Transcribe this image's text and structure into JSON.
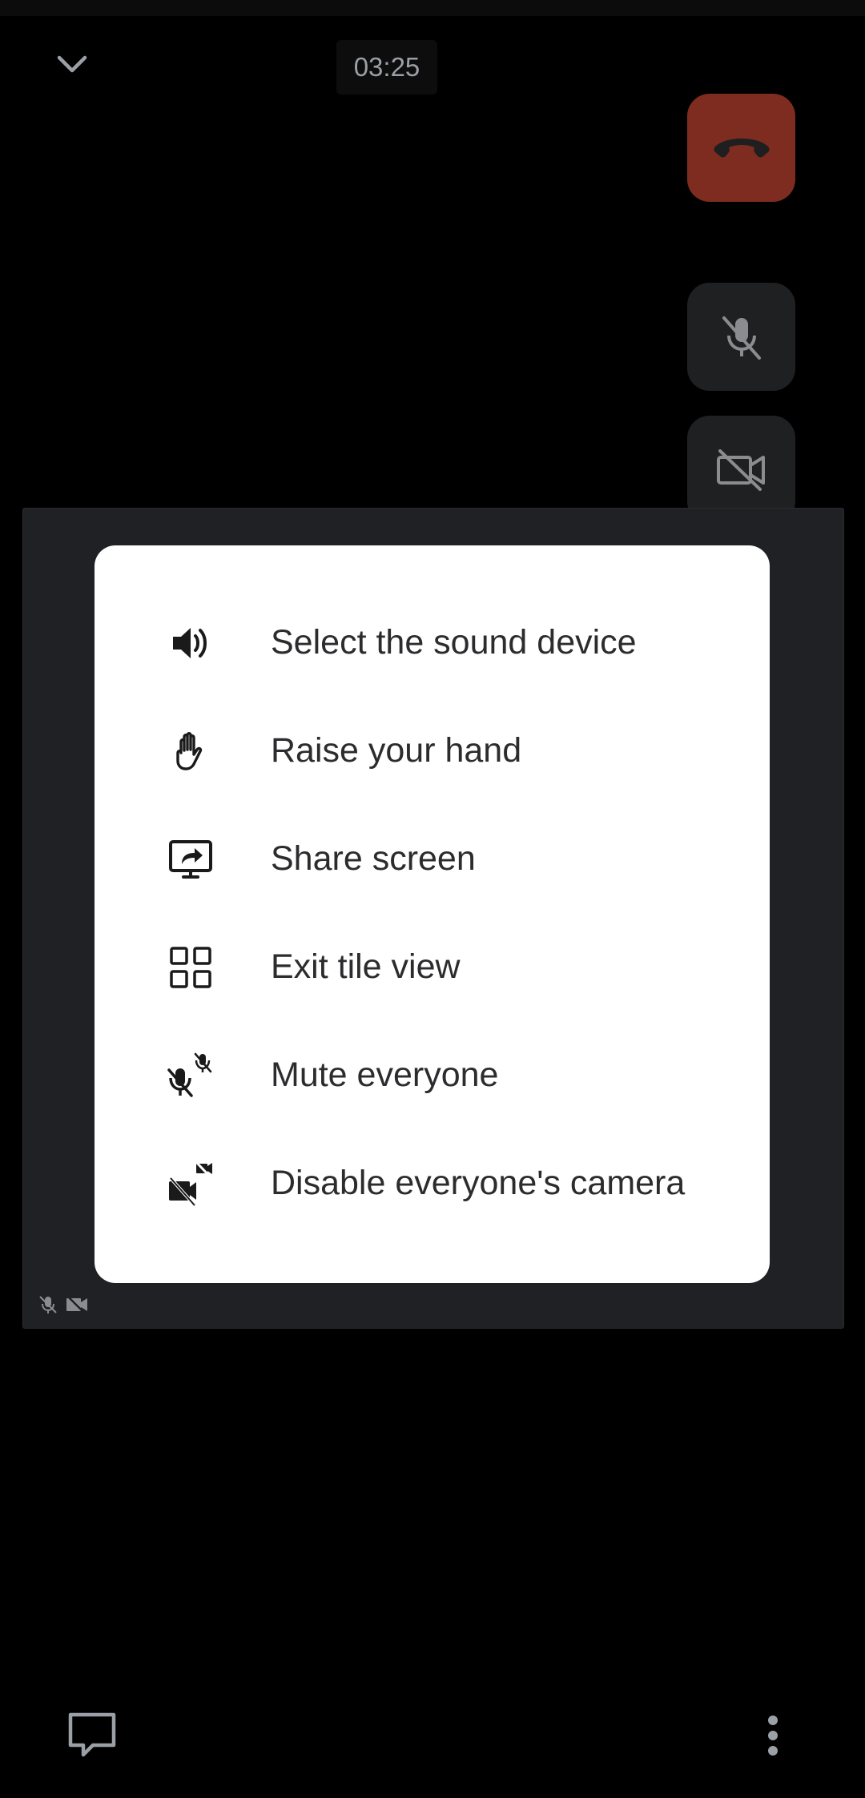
{
  "call": {
    "timer": "03:25"
  },
  "colors": {
    "hangup": "#7e2c20",
    "control_bg": "#1f2022",
    "tile_bg": "#202124",
    "menu_bg": "#ffffff",
    "menu_text": "#2c2c2e"
  },
  "top_bar": {
    "collapse_icon": "chevron-down-icon",
    "hangup_icon": "phone-hangup-icon"
  },
  "side_controls": [
    {
      "name": "hangup",
      "icon": "phone-hangup-icon"
    },
    {
      "name": "microphone",
      "icon": "mic-off-icon"
    },
    {
      "name": "camera",
      "icon": "camera-off-icon"
    }
  ],
  "tile": {
    "status_icons": [
      "mic-off-icon",
      "camera-off-icon"
    ]
  },
  "menu": {
    "items": [
      {
        "label": "Select the sound device",
        "icon": "speaker-icon"
      },
      {
        "label": "Raise your hand",
        "icon": "hand-icon"
      },
      {
        "label": "Share screen",
        "icon": "share-screen-icon"
      },
      {
        "label": "Exit tile view",
        "icon": "tile-view-icon"
      },
      {
        "label": "Mute everyone",
        "icon": "mute-everyone-icon"
      },
      {
        "label": "Disable everyone's camera",
        "icon": "disable-cameras-icon"
      }
    ]
  },
  "bottom_bar": {
    "chat_icon": "chat-icon",
    "more_icon": "more-vertical-icon"
  }
}
